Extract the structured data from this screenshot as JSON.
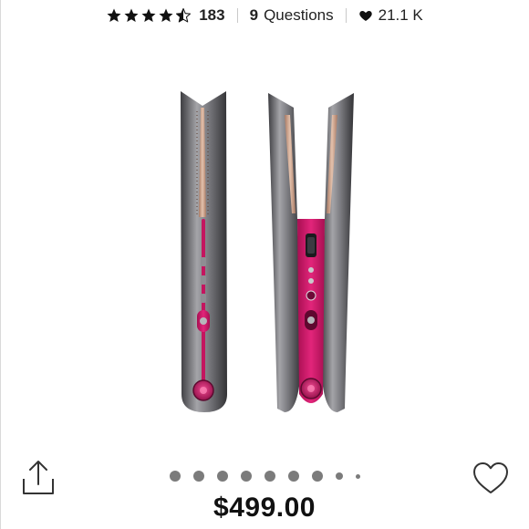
{
  "listing": {
    "rating": 4.5,
    "rating_max": 5,
    "review_count": "183",
    "question_count": "9",
    "question_label": "Questions",
    "likes": "21.1 K",
    "price": "$499.00"
  },
  "gallery": {
    "dot_count": 9,
    "active_index": 0
  },
  "icons": {
    "share": "share-icon",
    "like": "heart-outline-icon",
    "likes": "heart-filled-icon",
    "rating": "star-icon"
  },
  "colors": {
    "accent_fuchsia": "#d3186b",
    "body_nickel": "#6a6a6e",
    "plate_copper": "#c79a82"
  }
}
